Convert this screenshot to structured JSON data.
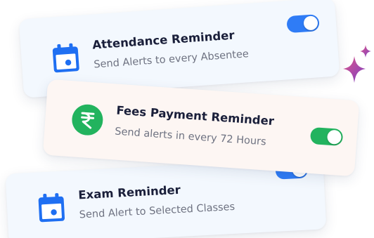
{
  "reminders": [
    {
      "title": "Attendance Reminder",
      "subtitle": "Send Alerts to every Absentee",
      "icon": "calendar-icon",
      "enabled": true,
      "toggle_color": "#2f7cf6"
    },
    {
      "title": "Fees Payment Reminder",
      "subtitle": "Send alerts in every 72 Hours",
      "icon": "rupee-icon",
      "enabled": true,
      "toggle_color": "#22b35e"
    },
    {
      "title": "Exam Reminder",
      "subtitle": "Send Alert to Selected Classes",
      "icon": "calendar-icon",
      "enabled": true,
      "toggle_color": "#2f7cf6"
    }
  ],
  "colors": {
    "calendar_icon": "#1f6ff2",
    "rupee_badge": "#22b35e",
    "sparkle_gradient_start": "#e0578a",
    "sparkle_gradient_end": "#7a3fc4"
  }
}
